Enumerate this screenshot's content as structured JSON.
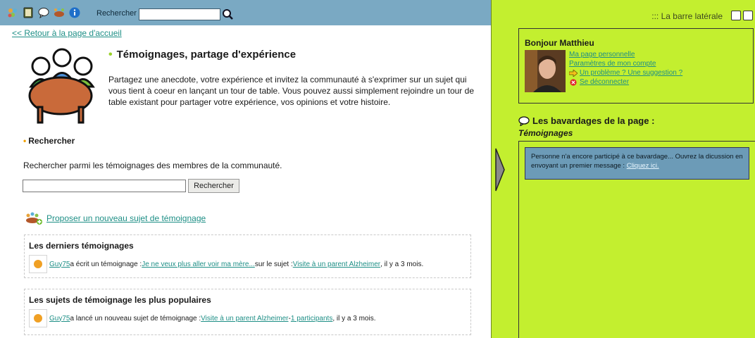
{
  "topbar": {
    "icons": [
      "community-icon",
      "book-icon",
      "chat-bubble-icon",
      "round-table-icon",
      "info-icon"
    ],
    "search_label": "Rechercher :",
    "search_value": "",
    "search_button_icon": "magnifier-icon"
  },
  "nav": {
    "back_link": "<< Retour à la page d'accueil"
  },
  "header": {
    "title": "Témoignages, partage d'expérience",
    "intro": "Partagez une anecdote, votre expérience et invitez la communauté à s'exprimer sur un sujet qui vous tient à coeur en lançant un tour de table. Vous pouvez aussi simplement rejoindre un tour de table existant pour partager votre expérience, vos opinions et votre histoire."
  },
  "search_section": {
    "heading": "Rechercher",
    "description": "Rechercher parmi les témoignages des membres de la communauté.",
    "input_value": "",
    "button_label": "Rechercher"
  },
  "propose_link": "Proposer un nouveau sujet de témoignage",
  "latest": {
    "title": "Les derniers témoignages",
    "row": {
      "user": "Guy75",
      "text1": " a écrit un témoignage : ",
      "link": "Je ne veux plus aller voir ma mère...",
      "text2": " sur le sujet : ",
      "topic": "Visite à un parent Alzheimer",
      "text3": ", il y a 3 mois."
    }
  },
  "popular": {
    "title": "Les sujets de témoignage les plus populaires",
    "row": {
      "user": "Guy75",
      "text1": " a lancé un nouveau sujet de témoignage : ",
      "topic": "Visite à un parent Alzheimer",
      "sep": " - ",
      "participants": "1 participants",
      "text2": ", il y a 3 mois."
    }
  },
  "sidebar": {
    "title": "::: La barre latérale",
    "greeting": "Bonjour Matthieu",
    "links": {
      "personal": "Ma page personnelle",
      "settings": "Paramètres de mon compte",
      "problem": "Un problème ? Une suggestion ?",
      "logout": "Se déconnecter"
    },
    "chat_heading": "Les bavardages de la page :",
    "chat_page": "Témoignages",
    "chat_message": "Personne n'a encore participé à ce bavardage... Ouvrez la dicussion en envoyant un premier message : ",
    "chat_link": "Cliquez ici."
  },
  "colors": {
    "topbar": "#7aa9c3",
    "sidebar": "#c3ef2f",
    "link": "#1e8f86",
    "chat_box": "#6c9bb7"
  }
}
